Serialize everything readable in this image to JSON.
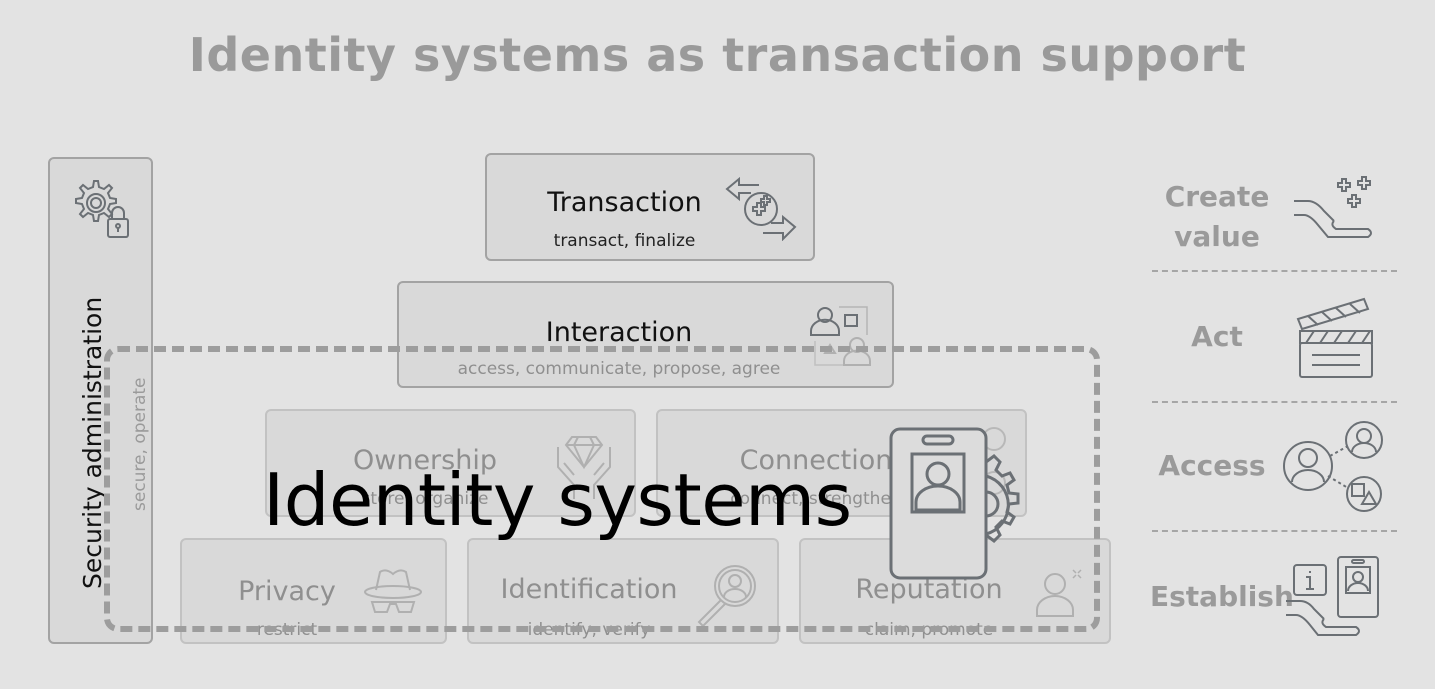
{
  "title": "Identity systems as transaction support",
  "security": {
    "label": "Security administration",
    "sub": "secure, operate",
    "icon": "gear-lock-icon"
  },
  "layers": {
    "transaction": {
      "label": "Transaction",
      "sub": "transact, finalize",
      "icon": "exchange-arrows-icon"
    },
    "interaction": {
      "label": "Interaction",
      "sub": "access, communicate, propose, agree",
      "icon": "people-shapes-icon"
    },
    "ownership": {
      "label": "Ownership",
      "sub": "store, organize",
      "icon": "hands-diamond-icon"
    },
    "connection": {
      "label": "Connection",
      "sub": "connect, strengthen",
      "icon": "network-people-icon"
    },
    "privacy": {
      "label": "Privacy",
      "sub": "restrict",
      "icon": "hat-glasses-icon"
    },
    "identification": {
      "label": "Identification",
      "sub": "identify, verify",
      "icon": "magnifier-person-icon"
    },
    "reputation": {
      "label": "Reputation",
      "sub": "claim, promote",
      "icon": "person-sparkle-icon"
    }
  },
  "overlay": {
    "label": "Identity systems",
    "icon": "id-badge-gear-icon"
  },
  "side": [
    {
      "label_line1": "Create",
      "label_line2": "value",
      "icon": "hand-plus-icon"
    },
    {
      "label_line1": "Act",
      "icon": "clapperboard-icon"
    },
    {
      "label_line1": "Access",
      "icon": "user-network-icon"
    },
    {
      "label_line1": "Establish",
      "icon": "hand-id-card-icon"
    }
  ],
  "colors": {
    "background": "#e3e3e3",
    "box_fill": "#d9d9d9",
    "box_border": "#a3a3a3",
    "muted_text": "#9a9a9a",
    "icon_stroke": "#6b7075",
    "dash": "#9d9d9d"
  }
}
